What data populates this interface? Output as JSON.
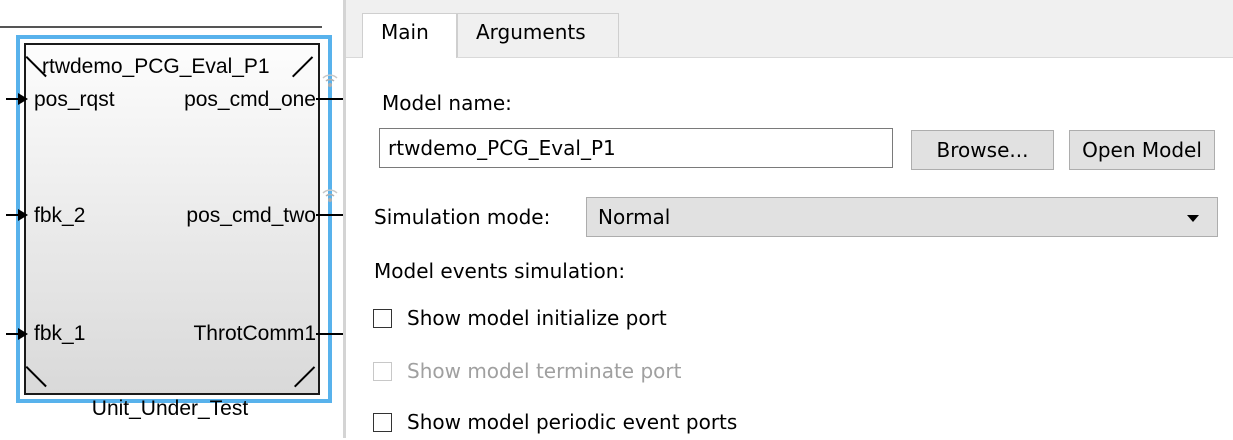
{
  "block": {
    "name": "rtwdemo_PCG_Eval_P1",
    "caption": "Unit_Under_Test",
    "inputs": [
      "pos_rqst",
      "fbk_2",
      "fbk_1"
    ],
    "outputs": [
      "pos_cmd_one",
      "pos_cmd_two",
      "ThrotComm1"
    ],
    "highlight_color": "#58b2ec"
  },
  "tabs": [
    {
      "label": "Main",
      "active": true
    },
    {
      "label": "Arguments",
      "active": false
    }
  ],
  "main": {
    "model_name_label": "Model name:",
    "model_name_value": "rtwdemo_PCG_Eval_P1",
    "browse_label": "Browse...",
    "open_model_label": "Open Model",
    "sim_mode_label": "Simulation mode:",
    "sim_mode_value": "Normal",
    "events_label": "Model events simulation:",
    "checkboxes": [
      {
        "label": "Show model initialize port",
        "checked": false,
        "enabled": true
      },
      {
        "label": "Show model terminate port",
        "checked": false,
        "enabled": false
      },
      {
        "label": "Show model periodic event ports",
        "checked": false,
        "enabled": true
      }
    ]
  }
}
